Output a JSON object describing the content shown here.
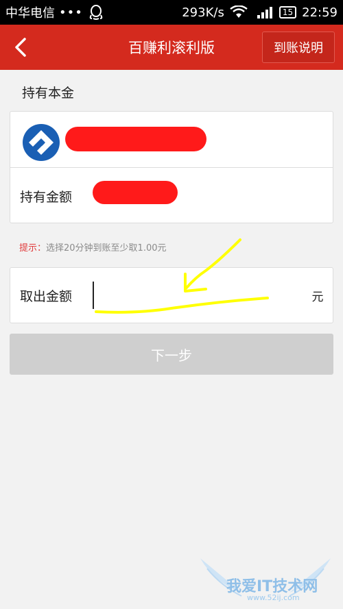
{
  "status_bar": {
    "carrier": "中华电信",
    "dots": "•••",
    "speed": "293K/s",
    "battery": "15",
    "time": "22:59"
  },
  "header": {
    "title": "百赚利滚利版",
    "help_button": "到账说明"
  },
  "holding": {
    "section_title": "持有本金",
    "amount_label": "持有金额"
  },
  "hint": {
    "prefix": "提示：",
    "text": "选择20分钟到账至少取1.00元"
  },
  "withdraw": {
    "label": "取出金额",
    "value": "",
    "unit": "元"
  },
  "next_button": "下一步",
  "watermark": {
    "main": "我爱IT技术网",
    "sub": "www.52ij.com"
  },
  "colors": {
    "header_bg": "#d42a1e",
    "hint_prefix": "#e0393a",
    "disabled_button": "#cfcfcf",
    "annotation": "#ffff00",
    "redaction": "#ff1a1a"
  }
}
